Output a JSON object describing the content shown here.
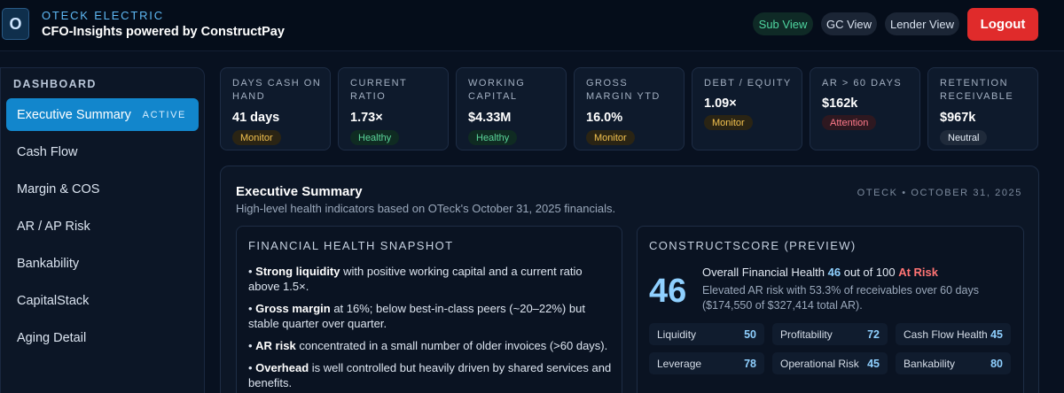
{
  "header": {
    "logo_letter": "O",
    "company": "OTECK ELECTRIC",
    "tagline": "CFO-Insights powered by ConstructPay",
    "views": [
      "Sub View",
      "GC View",
      "Lender View"
    ],
    "logout_label": "Logout"
  },
  "sidebar": {
    "heading": "DASHBOARD",
    "active_badge": "ACTIVE",
    "items": [
      {
        "label": "Executive Summary",
        "active": true
      },
      {
        "label": "Cash Flow"
      },
      {
        "label": "Margin & COS"
      },
      {
        "label": "AR / AP Risk"
      },
      {
        "label": "Bankability"
      },
      {
        "label": "CapitalStack"
      },
      {
        "label": "Aging Detail"
      }
    ]
  },
  "kpis": [
    {
      "label": "DAYS CASH ON HAND",
      "value": "41 days",
      "status": "Monitor"
    },
    {
      "label": "CURRENT RATIO",
      "value": "1.73×",
      "status": "Healthy"
    },
    {
      "label": "WORKING CAPITAL",
      "value": "$4.33M",
      "status": "Healthy"
    },
    {
      "label": "GROSS MARGIN YTD",
      "value": "16.0%",
      "status": "Monitor"
    },
    {
      "label": "DEBT / EQUITY",
      "value": "1.09×",
      "status": "Monitor"
    },
    {
      "label": "AR > 60 DAYS",
      "value": "$162k",
      "status": "Attention"
    },
    {
      "label": "RETENTION RECEIVABLE",
      "value": "$967k",
      "status": "Neutral"
    }
  ],
  "summary": {
    "title": "Executive Summary",
    "subtitle": "High-level health indicators based on OTeck's October 31, 2025 financials.",
    "meta": "OTECK • OCTOBER 31, 2025"
  },
  "snapshot": {
    "heading": "FINANCIAL HEALTH SNAPSHOT",
    "bullets": [
      {
        "bold": "Strong liquidity",
        "text": " with positive working capital and a current ratio above 1.5×."
      },
      {
        "bold": "Gross margin",
        "text": " at 16%; below best-in-class peers (~20–22%) but stable quarter over quarter."
      },
      {
        "bold": "AR risk",
        "text": " concentrated in a small number of older invoices (>60 days)."
      },
      {
        "bold": "Overhead",
        "text": " is well controlled but heavily driven by shared services and benefits."
      }
    ]
  },
  "constructscore": {
    "heading": "CONSTRUCTSCORE (PREVIEW)",
    "score": "46",
    "line_prefix": "Overall Financial Health",
    "line_score": "46",
    "line_mid": "out of 100",
    "line_risk": "At Risk",
    "detail": "Elevated AR risk with 53.3% of receivables over 60 days ($174,550 of $327,414 total AR).",
    "metrics": [
      {
        "label": "Liquidity",
        "value": "50"
      },
      {
        "label": "Profitability",
        "value": "72"
      },
      {
        "label": "Cash Flow Health",
        "value": "45"
      },
      {
        "label": "Leverage",
        "value": "78"
      },
      {
        "label": "Operational Risk",
        "value": "45"
      },
      {
        "label": "Bankability",
        "value": "80"
      }
    ]
  },
  "colors": {
    "background": "#081120",
    "accent": "#1286cc",
    "logout": "#e02b2b",
    "monitor": "#f2c14e",
    "healthy": "#5bd69a",
    "attention": "#ff7a8a",
    "risk": "#ff7474"
  }
}
